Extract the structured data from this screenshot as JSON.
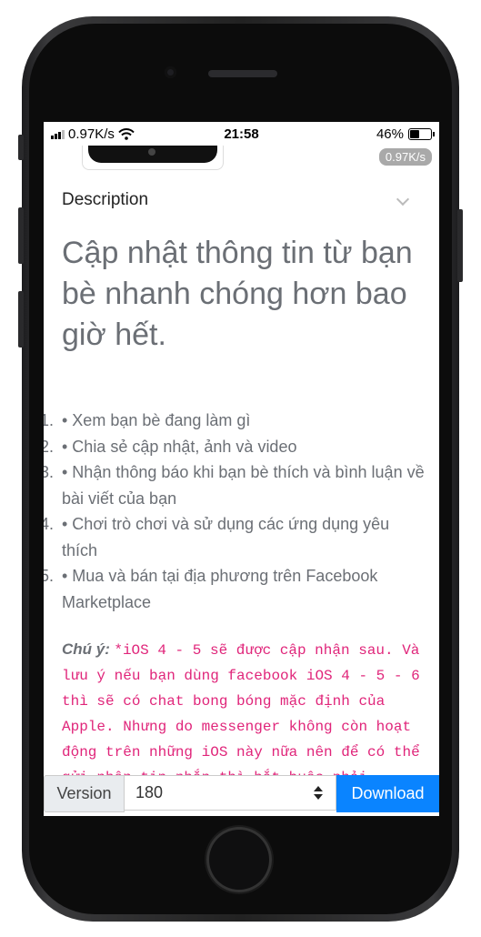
{
  "status_bar": {
    "network_speed": "0.97K/s",
    "time": "21:58",
    "battery": "46%",
    "speed_badge": "0.97K/s"
  },
  "description": {
    "header": "Description",
    "headline": "Cập nhật thông tin từ bạn bè nhanh chóng hơn bao giờ hết.",
    "features": [
      {
        "num": "1.",
        "text": "• Xem bạn bè đang làm gì"
      },
      {
        "num": "2.",
        "text": "• Chia sẻ cập nhật, ảnh và video"
      },
      {
        "num": "3.",
        "text": "• Nhận thông báo khi bạn bè thích và bình luận về bài viết của bạn"
      },
      {
        "num": "4.",
        "text": "• Chơi trò chơi và sử dụng các ứng dụng yêu thích"
      },
      {
        "num": "5.",
        "text": "• Mua và bán tại địa phương trên Facebook Marketplace"
      }
    ],
    "note_label": "Chú ý:",
    "note_text": "*iOS 4 - 5 sẽ được cập nhận sau. Và lưu ý nếu bạn dùng facebook iOS 4 - 5 - 6 thì sẽ có chat bong bóng mặc định của Apple. Nhưng do messenger không còn hoạt động trên những iOS này nữa nên để có thể gửi nhận tin nhắn thì bắt buộc phải JailBreak máy để FAKE VERSION*"
  },
  "bottom_bar": {
    "version_label": "Version",
    "version_value": "180",
    "download_label": "Download"
  },
  "colors": {
    "accent": "#0a84ff",
    "note_text": "#e0257a",
    "body_text": "#6b6f75"
  }
}
